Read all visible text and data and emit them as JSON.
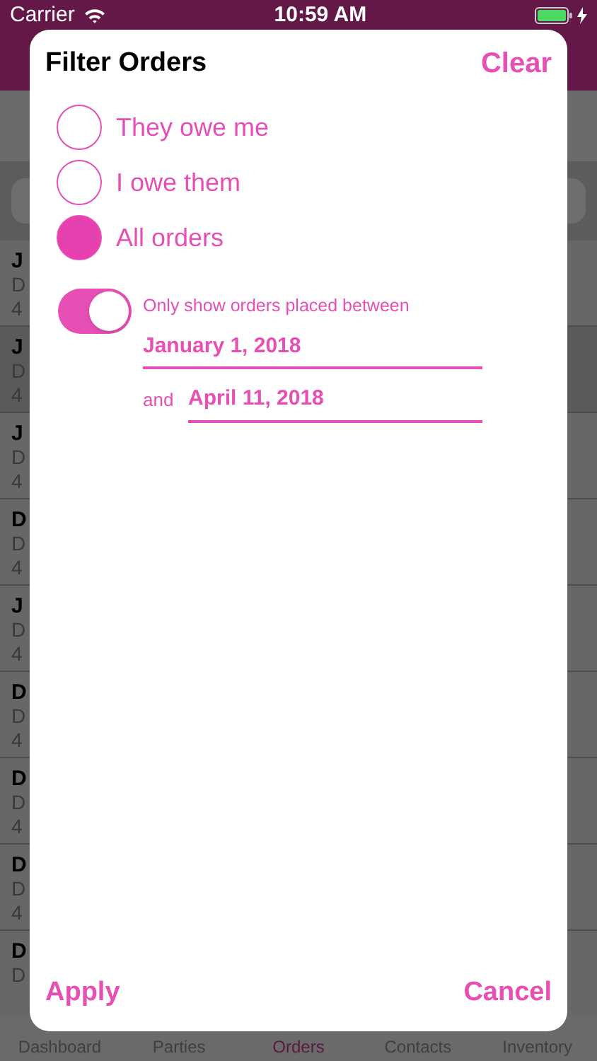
{
  "status_bar": {
    "carrier": "Carrier",
    "time": "10:59 AM"
  },
  "background_list": [
    {
      "title": "J",
      "detail": "D",
      "amount": "4",
      "selected": false
    },
    {
      "title": "J",
      "detail": "D",
      "amount": "4",
      "selected": true
    },
    {
      "title": "J",
      "detail": "D",
      "amount": "4",
      "selected": false
    },
    {
      "title": "D",
      "detail": "D",
      "amount": "4",
      "selected": false
    },
    {
      "title": "J",
      "detail": "D",
      "amount": "4",
      "selected": false
    },
    {
      "title": "D",
      "detail": "D",
      "amount": "4",
      "selected": false
    },
    {
      "title": "D",
      "detail": "D",
      "amount": "4",
      "selected": false
    },
    {
      "title": "D",
      "detail": "D",
      "amount": "4",
      "selected": false
    },
    {
      "title": "D",
      "detail": "D",
      "selected": false
    }
  ],
  "tab_bar": [
    {
      "label": "Dashboard",
      "selected": false
    },
    {
      "label": "Parties",
      "selected": false
    },
    {
      "label": "Orders",
      "selected": true
    },
    {
      "label": "Contacts",
      "selected": false
    },
    {
      "label": "Inventory",
      "selected": false
    }
  ],
  "dialog": {
    "title": "Filter Orders",
    "clear": "Clear",
    "options": [
      {
        "label": "They owe me",
        "selected": false
      },
      {
        "label": "I owe them",
        "selected": false
      },
      {
        "label": "All orders",
        "selected": true
      }
    ],
    "date_filter": {
      "on": true,
      "label": "Only show orders placed between",
      "start": "January 1, 2018",
      "joiner": "and",
      "end": "April 11, 2018"
    },
    "apply": "Apply",
    "cancel": "Cancel"
  }
}
